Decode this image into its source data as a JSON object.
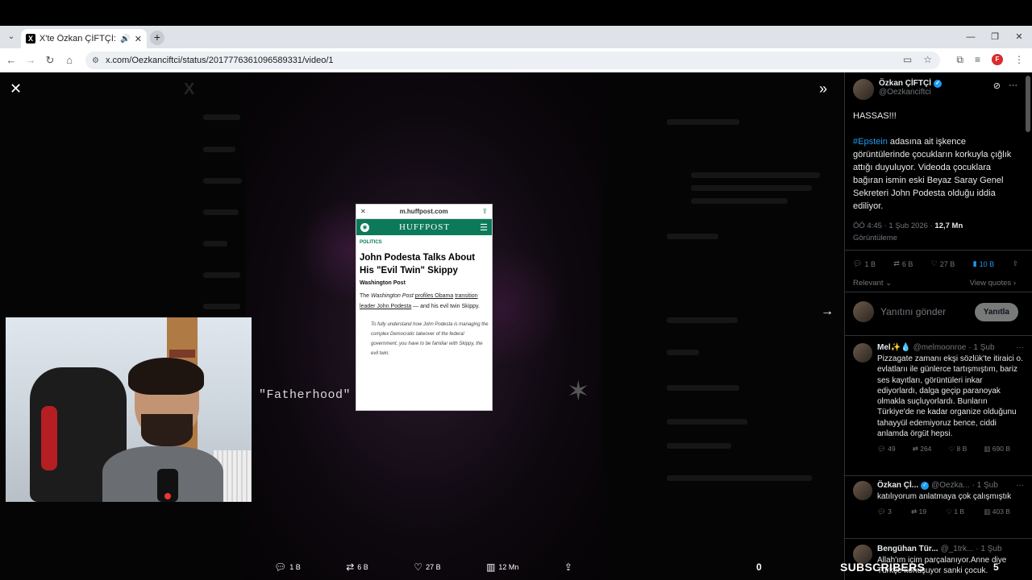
{
  "browser": {
    "tab_title": "X'te Özkan ÇİFTÇİ: \"HASSAS",
    "url": "x.com/Oezkanciftci/status/2017776361096589331/video/1"
  },
  "video_overlay": {
    "fatherhood_caption": "\"Fatherhood\"",
    "article": {
      "domain": "m.huffpost.com",
      "brand": "HUFFPOST",
      "kicker": "POLITICS",
      "title": "John Podesta Talks About His \"Evil Twin\" Skippy",
      "source": "Washington Post",
      "body_prefix": "The ",
      "body_paper": "Washington Post",
      "body_link1": "profiles Obama",
      "body_link2": "transition leader John Podesta",
      "body_suffix": " — and his evil twin Skippy.",
      "quote": "To fully understand how John Podesta is managing the complex Democratic takeover of the federal government, you have to be familiar with Skippy, the evil twin."
    }
  },
  "media_actions": {
    "replies": "1 B",
    "reposts": "6 B",
    "likes": "27 B",
    "views": "12 Mn"
  },
  "stream_overlay": {
    "left_count": "0",
    "subscribers_label": "SUBSCRIBERS",
    "right_count": "5"
  },
  "post": {
    "author_name": "Özkan ÇİFTÇİ",
    "author_handle": "@Oezkanciftci",
    "text_line1": "HASSAS!!!",
    "hashtag": "#Epstein",
    "text_body": " adasına ait işkence görüntülerinde çocukların korkuyla çığlık attığı duyuluyor. Videoda çocuklara bağıran ismin eski Beyaz Saray Genel Sekreteri John Podesta olduğu iddia ediliyor.",
    "time": "ÖÖ 4:45 · 1 Şub 2026 · ",
    "views": "12,7 Mn",
    "views_label": "Görüntüleme",
    "stats": {
      "replies": "1 B",
      "reposts": "6 B",
      "likes": "27 B",
      "bookmarks": "10 B"
    },
    "sort_label": "Relevant",
    "quotes_label": "View quotes",
    "reply_placeholder": "Yanıtını gönder",
    "reply_button": "Yanıtla"
  },
  "replies": [
    {
      "name": "Mel✨💧",
      "handle": "@melmoonroe",
      "time": "· 1 Şub",
      "text": "Pizzagate zamanı ekşi sözlük'te itiraici o. evlatlarıı ile günlerce tartışmıştım, bariz ses kayıtları, görüntüleri inkar ediyorlardı, dalga geçip paranoyak olmakla suçluyorlardı. Bunların Türkiye'de ne kadar organize olduğunu tahayyül edemiyoruz bence, ciddi anlamda örgüt hepsi.",
      "replies": "49",
      "reposts": "264",
      "likes": "8 B",
      "views": "690 B"
    },
    {
      "name": "Özkan Çİ...",
      "handle": "@Oezka...",
      "time": "· 1 Şub",
      "text": "katılıyorum anlatmaya çok çalışmıştık",
      "replies": "3",
      "reposts": "19",
      "likes": "1 B",
      "views": "403 B"
    },
    {
      "name": "Bengühan Tür...",
      "handle": "@_1trk...",
      "time": "· 1 Şub",
      "text": "Allah'ım içim parçalanıyor.Anne diye Türkçe konuşuyor sanki çocuk."
    }
  ],
  "colors": {
    "accent": "#1d9bf0",
    "huffpost_green": "#0c7a5a"
  }
}
